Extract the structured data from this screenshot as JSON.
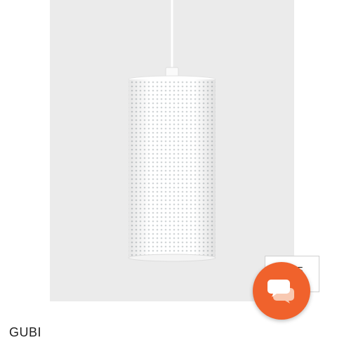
{
  "product": {
    "brand": "GUBI",
    "image_icon": "pendant-lamp-image"
  },
  "badge": {
    "label": "5"
  },
  "chat": {
    "icon": "chat-bubbles-icon",
    "accent": "#f0622c"
  }
}
